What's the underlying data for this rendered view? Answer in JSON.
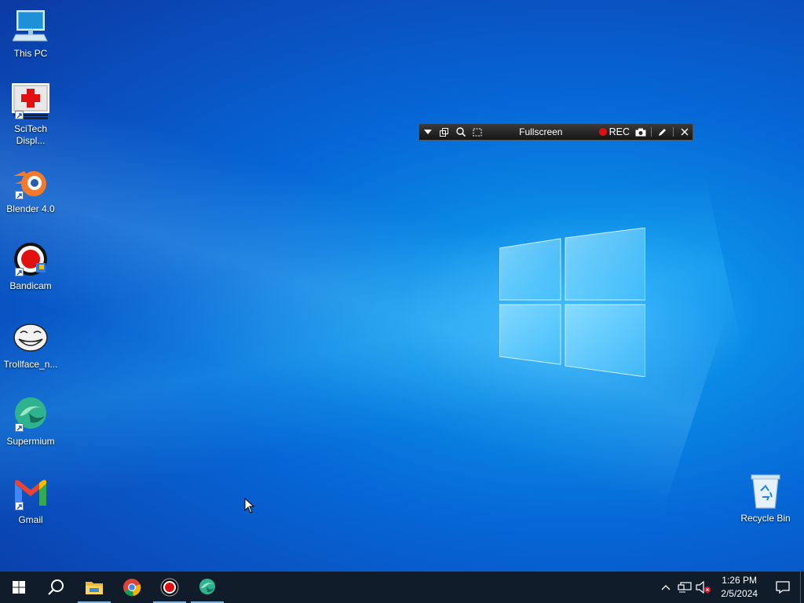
{
  "desktop_icons": [
    {
      "name": "This PC",
      "icon": "this-pc-icon"
    },
    {
      "name": "SciTech Displ...",
      "icon": "scitech-display-icon"
    },
    {
      "name": "Blender 4.0",
      "icon": "blender-icon"
    },
    {
      "name": "Bandicam",
      "icon": "bandicam-icon"
    },
    {
      "name": "Trollface_n...",
      "icon": "trollface-icon"
    },
    {
      "name": "Supermium",
      "icon": "supermium-icon"
    },
    {
      "name": "Gmail",
      "icon": "gmail-icon"
    }
  ],
  "recycle_bin": {
    "name": "Recycle Bin"
  },
  "bandicam_bar": {
    "mode": "Fullscreen",
    "rec_label": "REC"
  },
  "taskbar": {
    "apps": [
      "start-icon",
      "search-icon",
      "file-explorer-icon",
      "chrome-icon",
      "bandicam-icon",
      "supermium-icon"
    ]
  },
  "clock": {
    "time": "1:26 PM",
    "date": "2/5/2024"
  },
  "colors": {
    "taskbar": "#101c2a",
    "accent": "#0a8be6",
    "rec": "#e01010"
  }
}
